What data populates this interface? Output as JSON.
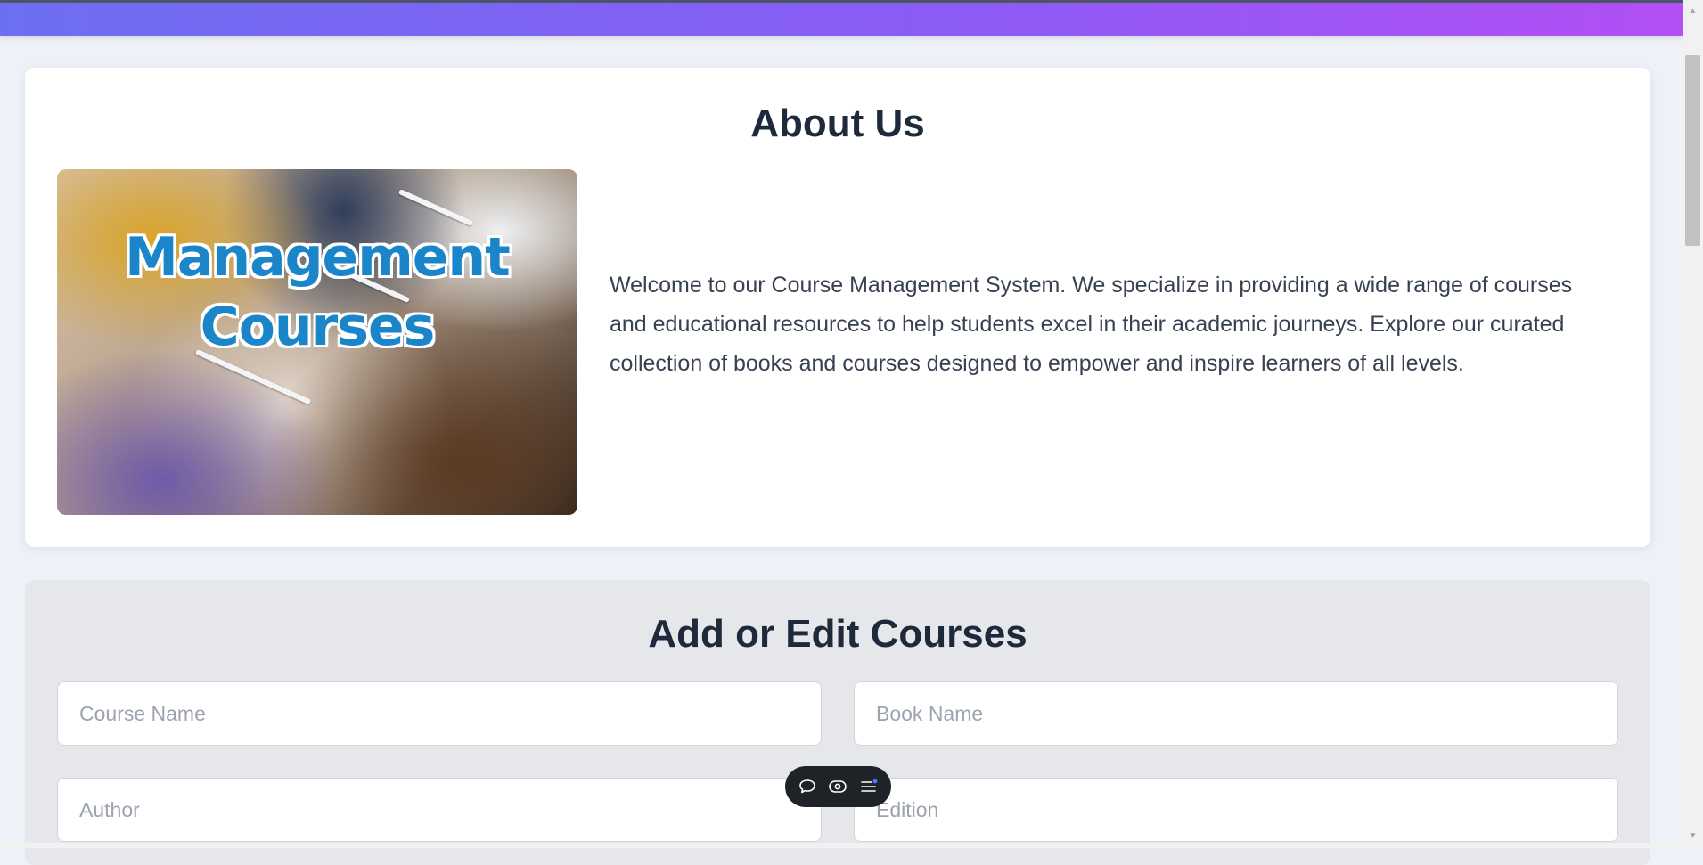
{
  "about": {
    "title": "About Us",
    "image_line1": "Management",
    "image_line2": "Courses",
    "description": "Welcome to our Course Management System. We specialize in providing a wide range of courses and educational resources to help students excel in their academic journeys. Explore our curated collection of books and courses designed to empower and inspire learners of all levels."
  },
  "form": {
    "title": "Add or Edit Courses",
    "course_name_placeholder": "Course Name",
    "book_name_placeholder": "Book Name",
    "author_placeholder": "Author",
    "edition_placeholder": "Edition"
  },
  "toolbar": {
    "icons": [
      "comment-icon",
      "eye-icon",
      "menu-icon"
    ]
  },
  "colors": {
    "header_gradient_start": "#6d6ff2",
    "header_gradient_end": "#b24ff5",
    "image_text": "#1a86c9",
    "heading": "#1e293b"
  }
}
